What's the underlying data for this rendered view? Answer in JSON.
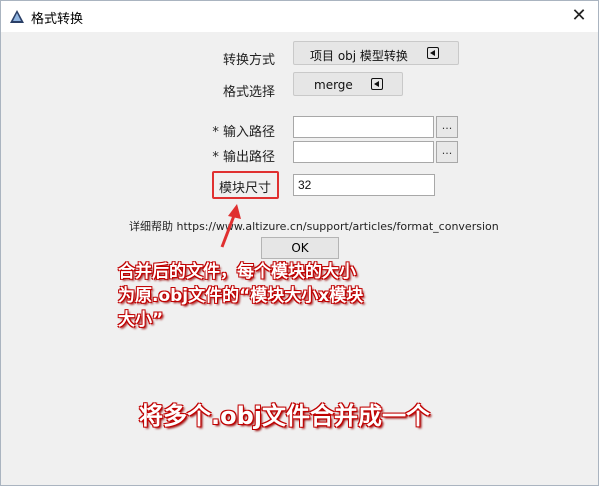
{
  "window": {
    "title": "格式转换",
    "close_glyph": "✕"
  },
  "form": {
    "conversion_method_label": "转换方式",
    "conversion_method_value": "项目 obj 模型转换",
    "format_select_label": "格式选择",
    "format_select_value": "merge",
    "input_path_label": "* 输入路径",
    "input_path_value": "",
    "output_path_label": "* 输出路径",
    "output_path_value": "",
    "browse_label": "...",
    "block_size_label": "模块尺寸",
    "block_size_value": "32",
    "help_prefix": "详细帮助",
    "help_url": "https://www.altizure.cn/support/articles/format_conversion",
    "ok_label": "OK"
  },
  "annotations": {
    "callout_text": "合并后的文件，每个模块的大小为原.obj文件的“模块大小x模块大小”",
    "caption": "将多个.obj文件合并成一个"
  },
  "colors": {
    "highlight": "#e03030",
    "annotation_outline": "#c00000"
  },
  "icons": {
    "app": "app-logo-icon",
    "dropdown": "triangle-left-icon"
  }
}
